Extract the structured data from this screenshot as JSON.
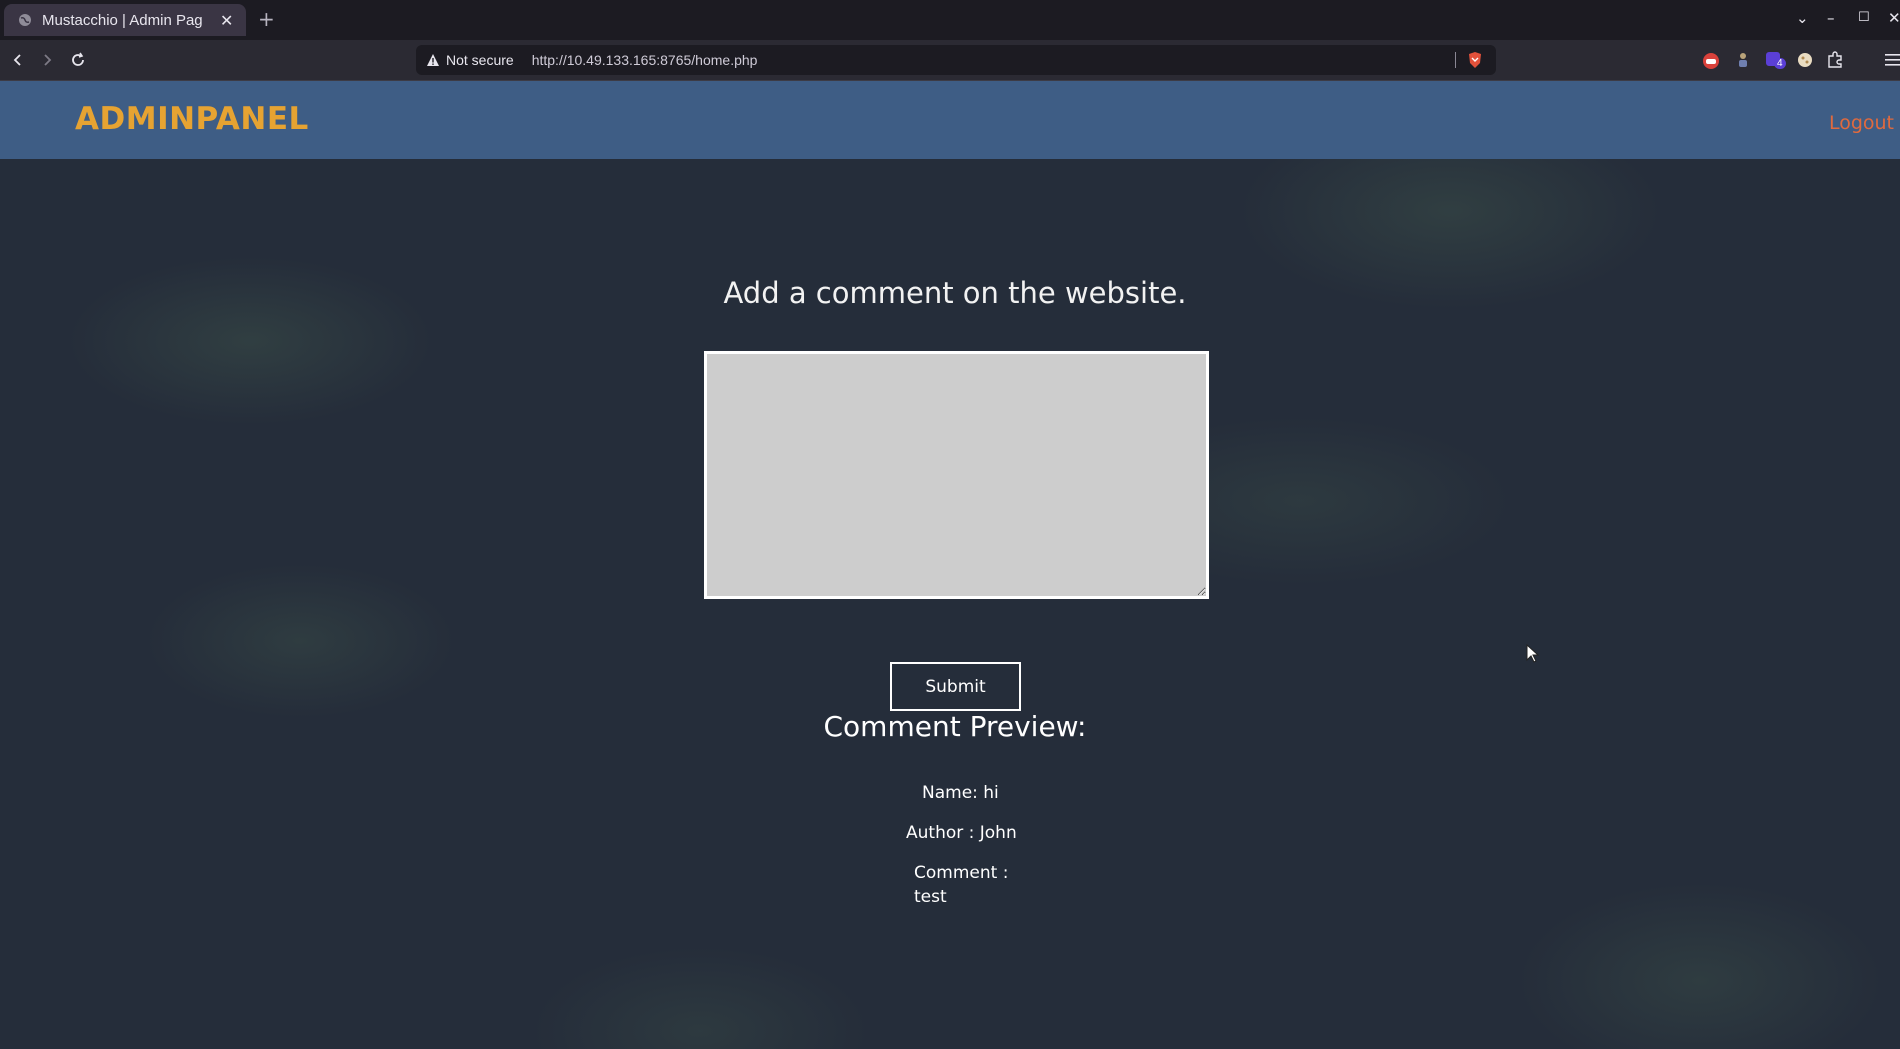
{
  "browser": {
    "tab_title": "Mustacchio | Admin Pag",
    "new_tab": "+",
    "not_secure": "Not secure",
    "url": "http://10.49.133.165:8765/home.php",
    "extension_badge": "4"
  },
  "navbar": {
    "brand": "ADMINPANEL",
    "logout": "Logout"
  },
  "form": {
    "heading": "Add a comment on the website.",
    "textarea_value": "",
    "submit_label": "Submit"
  },
  "preview": {
    "title": "Comment Preview:",
    "name_line": "Name: hi",
    "author_line": "Author : John",
    "comment_label": "Comment :",
    "comment_text": "test"
  },
  "colors": {
    "navbar_bg": "#3e5d85",
    "brand": "#e6a332",
    "logout": "#e06a3e",
    "page_bg": "#252d3a",
    "textarea_bg": "#cdcdcd"
  }
}
